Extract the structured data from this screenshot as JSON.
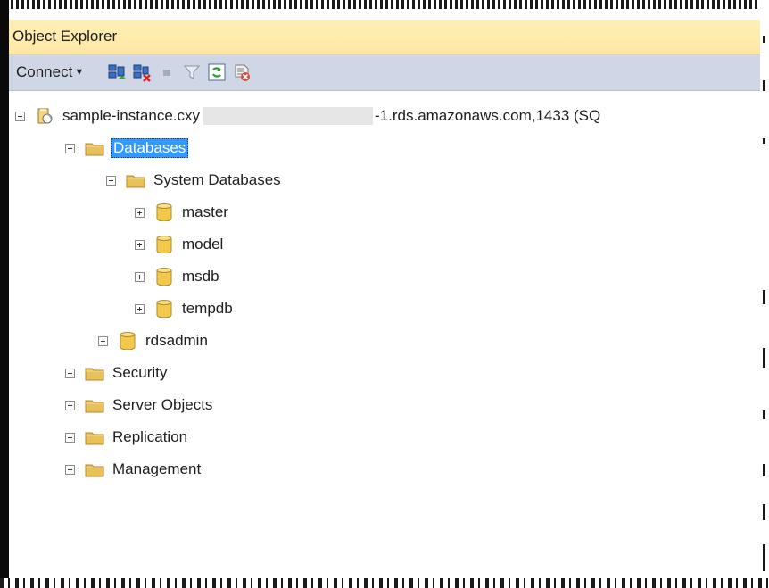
{
  "panel": {
    "title": "Object Explorer"
  },
  "toolbar": {
    "connect_label": "Connect",
    "icons": [
      "connect-object-explorer-icon",
      "disconnect-icon",
      "stop-icon",
      "filter-icon",
      "refresh-icon",
      "sync-icon"
    ]
  },
  "tree": {
    "server": {
      "label_prefix": "sample-instance.cxy",
      "label_suffix": "-1.rds.amazonaws.com,1433 (SQ"
    },
    "databases": "Databases",
    "system_databases": "System Databases",
    "system_dbs": [
      "master",
      "model",
      "msdb",
      "tempdb"
    ],
    "user_dbs": [
      "rdsadmin"
    ],
    "top_level": [
      "Security",
      "Server Objects",
      "Replication",
      "Management"
    ]
  },
  "colors": {
    "titlebar": "#ffe8a3",
    "toolbar": "#cfd6e5",
    "selection": "#3399ff",
    "folder": "#e8c15a",
    "database": "#f2c94c"
  }
}
